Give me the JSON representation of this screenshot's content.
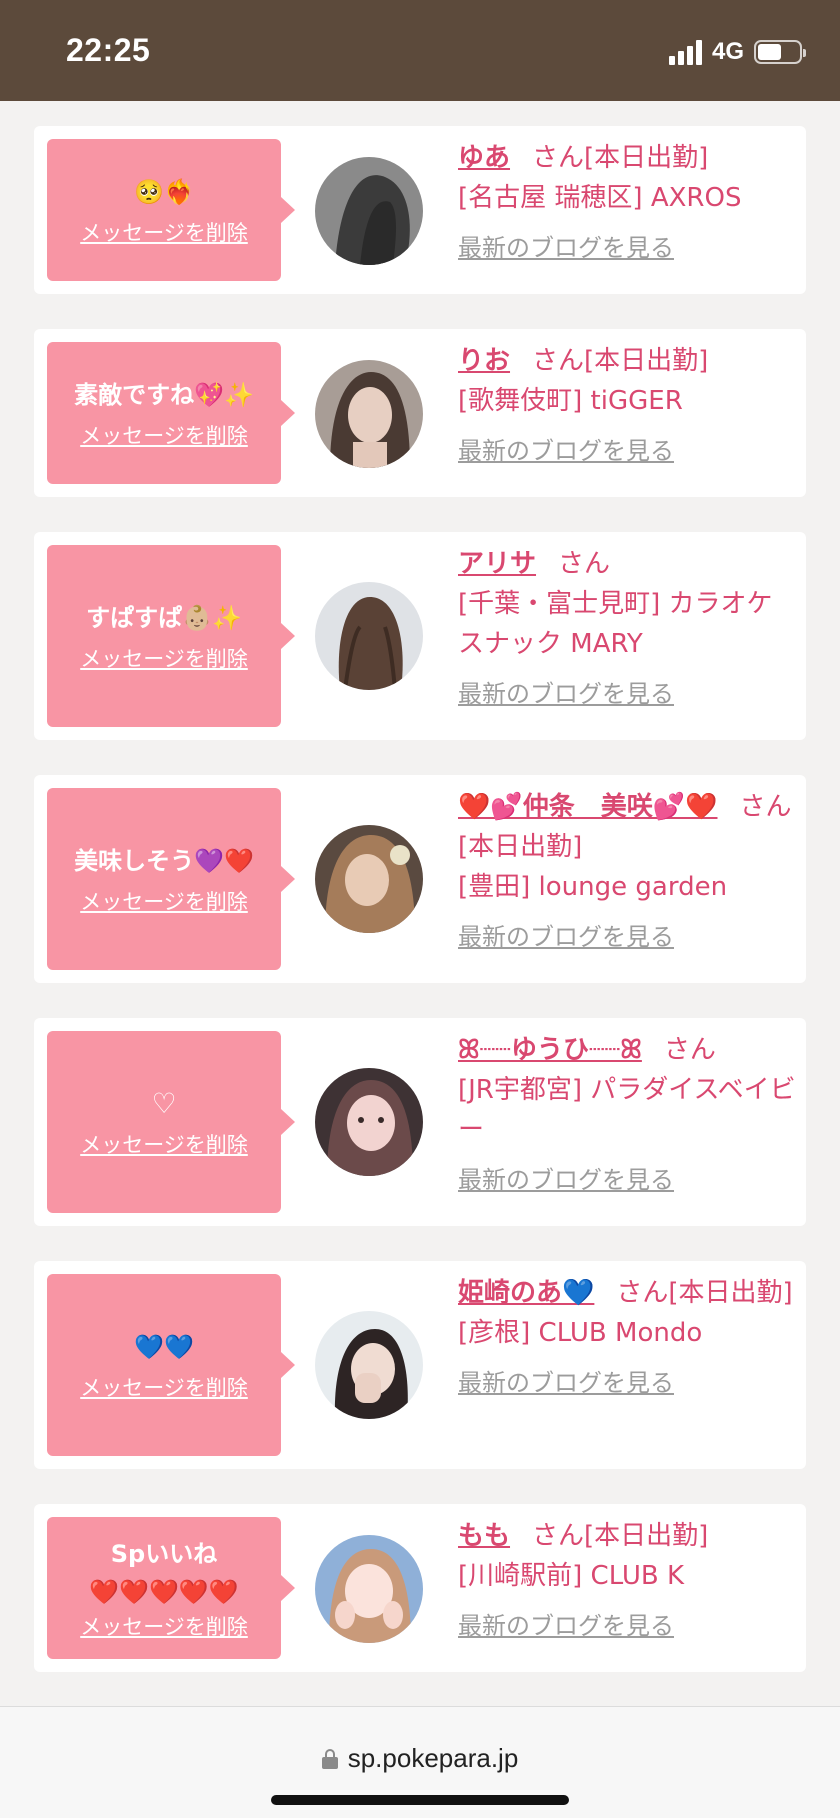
{
  "status_bar": {
    "time": "22:25",
    "network": "4G"
  },
  "common": {
    "delete_label": "メッセージを削除",
    "blog_label": "最新のブログを見る",
    "san": "さん"
  },
  "cards": [
    {
      "message": "🥺❤️‍🔥",
      "name": "ゆあ",
      "status": "[本日出勤]",
      "shop": "[名古屋 瑞穂区] AXROS",
      "avatar_color": "#4a4a4a"
    },
    {
      "message": "素敵ですね💖✨",
      "name": "りお",
      "status": "[本日出勤]",
      "shop": "[歌舞伎町] tiGGER",
      "avatar_color": "#8b7f76"
    },
    {
      "message": "すぱすぱ👶🏼✨",
      "name": "アリサ",
      "status": "",
      "shop": "[千葉・富士見町] カラオケスナック MARY",
      "avatar_color": "#6a5446"
    },
    {
      "message": "美味しそう💜❤️",
      "name": "❤️💕仲条　美咲💕❤️",
      "status": "[本日出勤]",
      "shop": "[豊田] lounge garden",
      "avatar_color": "#7a6050"
    },
    {
      "message": "♡",
      "name": "ꕤ┈┈ゆうひ┈┈ꕤ",
      "status": "",
      "shop": "[JR宇都宮] パラダイスベイビー",
      "avatar_color": "#8e6e70"
    },
    {
      "message": "💙💙",
      "name": "姫崎のあ💙",
      "status": "[本日出勤]",
      "shop": "[彦根] CLUB Mondo",
      "avatar_color": "#b8c3c9"
    },
    {
      "message": "Spいいね\n❤️❤️❤️❤️❤️",
      "name": "もも",
      "status": "[本日出勤]",
      "shop": "[川崎駅前] CLUB K",
      "avatar_color": "#6f8fb3"
    }
  ],
  "browser": {
    "url": "sp.pokepara.jp"
  }
}
